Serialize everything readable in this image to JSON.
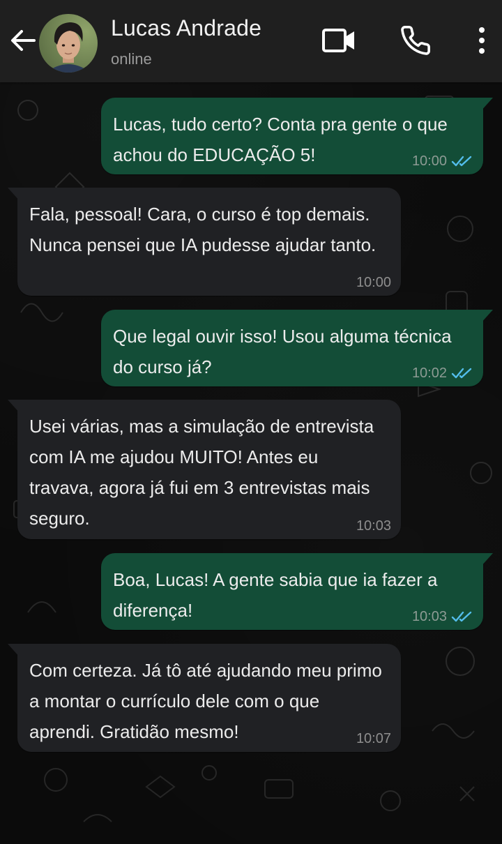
{
  "header": {
    "contact_name": "Lucas Andrade",
    "contact_status": "online",
    "icons": [
      "back-arrow-icon",
      "avatar",
      "video-call-icon",
      "phone-icon",
      "more-vertical-icon"
    ]
  },
  "messages": [
    {
      "direction": "out",
      "text": "Lucas, tudo certo? Conta pra gente o que achou do EDUCAÇÃO 5!",
      "time": "10:00",
      "read": true
    },
    {
      "direction": "in",
      "text": "Fala, pessoal! Cara, o curso é top demais. Nunca pensei que IA pudesse ajudar tanto.",
      "time": "10:00"
    },
    {
      "direction": "out",
      "text": "Que legal ouvir isso! Usou alguma técnica do curso já?",
      "time": "10:02",
      "read": true
    },
    {
      "direction": "in",
      "text": "Usei várias, mas a simulação de entrevista com IA me ajudou MUITO! Antes eu travava, agora já fui em 3 entrevistas mais seguro.",
      "time": "10:03"
    },
    {
      "direction": "out",
      "text": "Boa, Lucas! A gente sabia que ia fazer a diferença!",
      "time": "10:03",
      "read": true
    },
    {
      "direction": "in",
      "text": "Com certeza. Já tô até ajudando meu primo a montar o currículo dele com o que aprendi. Gratidão mesmo!",
      "time": "10:07"
    }
  ],
  "colors": {
    "header_bg": "#1f1f1f",
    "chat_bg": "#0b0b0b",
    "outgoing_bubble": "#134d37",
    "incoming_bubble": "#202124",
    "read_ticks": "#53bdeb"
  }
}
